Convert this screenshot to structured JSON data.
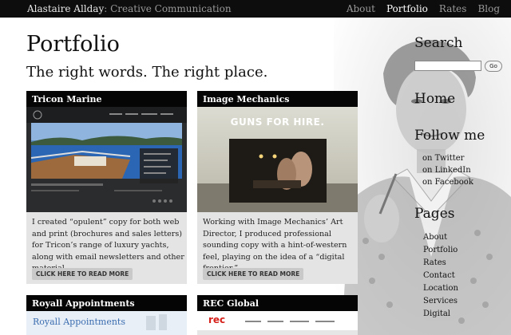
{
  "header": {
    "brand_name": "Alastaire Allday",
    "brand_tagline": ": Creative Communication",
    "nav": [
      {
        "label": "About"
      },
      {
        "label": "Portfolio"
      },
      {
        "label": "Rates"
      },
      {
        "label": "Blog"
      }
    ],
    "active_nav": "Portfolio"
  },
  "main": {
    "title": "Portfolio",
    "subtitle": "The right words. The right place.",
    "cards": [
      {
        "title": "Tricon Marine",
        "text": "I created “opulent” copy for both web and print (brochures and sales letters) for Tricon’s range of luxury yachts, along with email newsletters and other material.",
        "button": "CLICK HERE TO READ MORE"
      },
      {
        "title": "Image Mechanics",
        "thumb_headline": "GUNS FOR HIRE.",
        "text": "Working with Image Mechanics’ Art Director, I produced professional sounding copy with a hint-of-western feel, playing on the idea of a “digital frontier.”",
        "button": "CLICK HERE TO READ MORE"
      },
      {
        "title": "Royall Appointments",
        "thumb_headline": "Royall Appointments"
      },
      {
        "title": "REC Global",
        "thumb_logo": "rec"
      }
    ]
  },
  "sidebar": {
    "search_heading": "Search",
    "search_button": "Go",
    "home_heading": "Home",
    "follow_heading": "Follow me",
    "follow_links": [
      "on Twitter",
      "on LinkedIn",
      "on Facebook"
    ],
    "pages_heading": "Pages",
    "pages": [
      "About",
      "Portfolio",
      "Rates",
      "Contact",
      "Location",
      "Services",
      "Digital"
    ]
  },
  "colors": {
    "topbar": "#0d0d0d",
    "card_bg": "#e4e4e4",
    "card_title_bg": "#050505",
    "button_bg": "#c9c9c9",
    "rec_red": "#d6211b"
  }
}
